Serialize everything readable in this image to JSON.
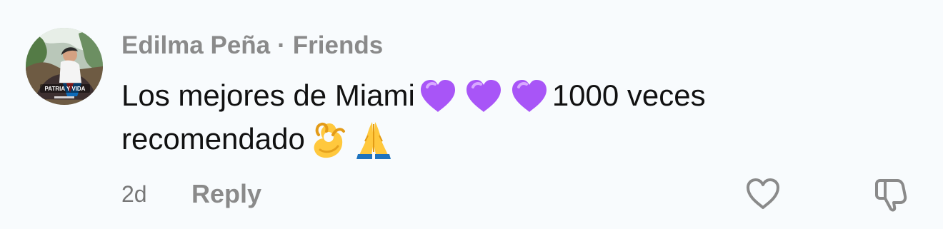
{
  "comment": {
    "author": "Edilma Peña",
    "separator": "·",
    "relationship": "Friends",
    "text_line_1": "Los mejores de Miami ",
    "text_count": "1000 veces",
    "text_line_2": "recomendado ",
    "avatar_text": "PATRIA Y VIDA",
    "age": "2d",
    "reply_label": "Reply"
  },
  "icons": {
    "hearts": [
      "purple-heart-icon",
      "purple-heart-icon",
      "purple-heart-icon"
    ],
    "ok_hand": "ok-hand-icon",
    "folded_hands": "folded-hands-icon",
    "like": "heart-outline-icon",
    "dislike": "thumbs-down-icon"
  },
  "colors": {
    "background": "#f8fbfd",
    "author": "#8a8a8a",
    "text": "#111111",
    "meta": "#777777",
    "heart": "#a855f7",
    "emoji_yellow": "#ffc83d",
    "icon_stroke": "#8a8a8a"
  }
}
